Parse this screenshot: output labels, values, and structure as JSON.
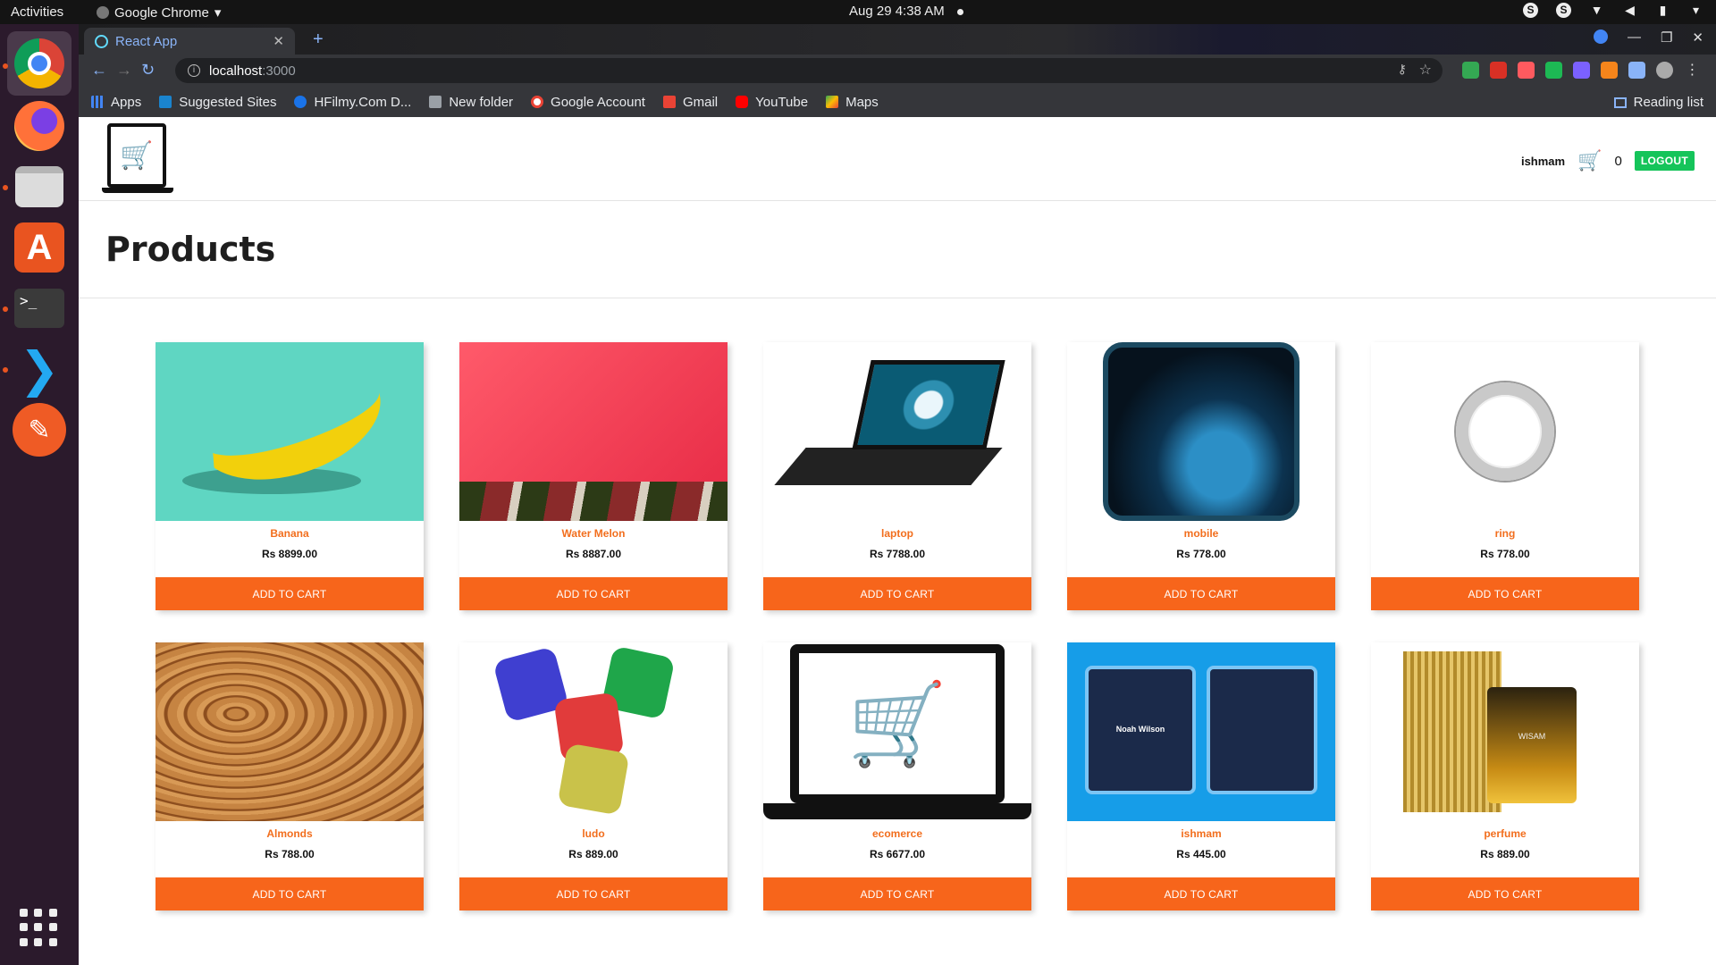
{
  "os": {
    "activities": "Activities",
    "app_name": "Google Chrome",
    "clock": "Aug 29  4:38 AM"
  },
  "browser": {
    "tab_title": "React App",
    "url_host": "localhost",
    "url_port": ":3000",
    "bookmarks": [
      {
        "label": "Apps",
        "icon": "apps-grid-icon"
      },
      {
        "label": "Suggested Sites",
        "icon": "bing-icon"
      },
      {
        "label": "HFilmy.Com D...",
        "icon": "globe-icon"
      },
      {
        "label": "New folder",
        "icon": "folder-icon"
      },
      {
        "label": "Google Account",
        "icon": "google-icon"
      },
      {
        "label": "Gmail",
        "icon": "gmail-icon"
      },
      {
        "label": "YouTube",
        "icon": "youtube-icon"
      },
      {
        "label": "Maps",
        "icon": "maps-icon"
      }
    ],
    "reading_list": "Reading list"
  },
  "navbar": {
    "username": "ishmam",
    "cart_count": "0",
    "logout_label": "LOGOUT"
  },
  "page": {
    "heading": "Products"
  },
  "products": [
    {
      "name": "Banana",
      "price": "Rs 8899.00",
      "button": "ADD TO CART"
    },
    {
      "name": "Water Melon",
      "price": "Rs 8887.00",
      "button": "ADD TO CART"
    },
    {
      "name": "laptop",
      "price": "Rs 7788.00",
      "button": "ADD TO CART"
    },
    {
      "name": "mobile",
      "price": "Rs 778.00",
      "button": "ADD TO CART"
    },
    {
      "name": "ring",
      "price": "Rs 778.00",
      "button": "ADD TO CART"
    },
    {
      "name": "Almonds",
      "price": "Rs 788.00",
      "button": "ADD TO CART"
    },
    {
      "name": "ludo",
      "price": "Rs 889.00",
      "button": "ADD TO CART"
    },
    {
      "name": "ecomerce",
      "price": "Rs 6677.00",
      "button": "ADD TO CART"
    },
    {
      "name": "ishmam",
      "price": "Rs 445.00",
      "button": "ADD TO CART"
    },
    {
      "name": "perfume",
      "price": "Rs 889.00",
      "button": "ADD TO CART"
    }
  ],
  "id_card_name": "Noah Wilson",
  "perfume_label": "WISAM",
  "colors": {
    "accent_orange": "#f7651b",
    "product_name": "#f26e1d",
    "logout_green": "#15c45a"
  }
}
